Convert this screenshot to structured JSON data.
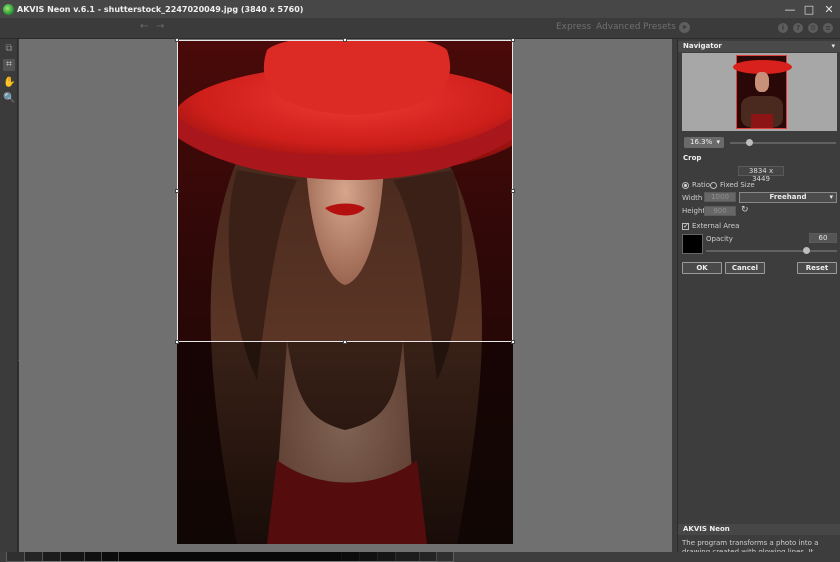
{
  "window": {
    "title": "AKVIS Neon v.6.1 - shutterstock_2247020049.jpg (3840 x 5760)",
    "minimize_glyph": "—",
    "maximize_glyph": "□",
    "close_glyph": "✕"
  },
  "toolbar": {
    "modes": [
      "Express",
      "Advanced",
      "Presets"
    ],
    "undo_glyph": "←",
    "redo_glyph": "→",
    "help_glyphs": [
      "i",
      "?",
      "⚙",
      "≡"
    ]
  },
  "left_tools": {
    "glyphs": [
      "⧉",
      "⌗",
      "✋",
      "🔍"
    ]
  },
  "navigator": {
    "title": "Navigator",
    "collapse_glyph": "▾",
    "zoom": "16.3%",
    "zoom_arrow": "▾"
  },
  "crop": {
    "title": "Crop",
    "size": "3834 x 3449",
    "ratio_label": "Ratio",
    "fixed_size_label": "Fixed Size",
    "width_label": "Width",
    "height_label": "Height",
    "width_value": "1000",
    "height_value": "900",
    "ratio_select": "Freehand",
    "ratio_arrow": "▾",
    "refresh_glyph": "↻",
    "external_area_label": "External Area",
    "external_area_check": "✓",
    "opacity_label": "Opacity",
    "opacity_value": "60",
    "opacity_level": 0.78,
    "ok_label": "OK",
    "cancel_label": "Cancel",
    "reset_label": "Reset"
  },
  "info": {
    "title": "AKVIS Neon",
    "text": "The program transforms a photo into a drawing created with glowing lines. It brings outstanding"
  },
  "colors": {
    "panel": "#3d3d3d",
    "canvas": "#707070",
    "hat_red": "#d8211d"
  }
}
